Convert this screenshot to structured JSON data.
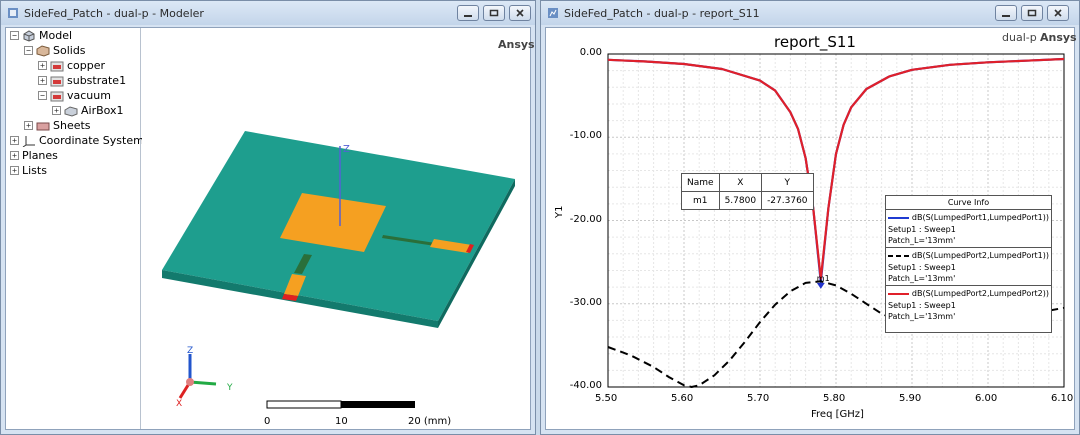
{
  "left_window": {
    "title": "SideFed_Patch - dual-p - Modeler",
    "tree": {
      "items": [
        {
          "label": "Model",
          "level": 0,
          "expander": "−"
        },
        {
          "label": "Solids",
          "level": 1,
          "expander": "−"
        },
        {
          "label": "copper",
          "level": 2,
          "expander": "+"
        },
        {
          "label": "substrate1",
          "level": 2,
          "expander": "+"
        },
        {
          "label": "vacuum",
          "level": 2,
          "expander": "−"
        },
        {
          "label": "AirBox1",
          "level": 3,
          "expander": "+"
        },
        {
          "label": "Sheets",
          "level": 1,
          "expander": "+"
        },
        {
          "label": "Coordinate Systems",
          "level": 0,
          "expander": "+"
        },
        {
          "label": "Planes",
          "level": 0,
          "expander": "+"
        },
        {
          "label": "Lists",
          "level": 0,
          "expander": "+"
        }
      ]
    },
    "view": {
      "brand": "Ansys",
      "axis_z": "Z",
      "triad": {
        "z": "Z",
        "x": "X",
        "y": "Y"
      },
      "scale_ticks": [
        "0",
        "10",
        "20 (mm)"
      ],
      "colors": {
        "substrate": "#1e9e8e",
        "patch": "#f5a021",
        "port": "#e02020"
      }
    }
  },
  "right_window": {
    "title": "SideFed_Patch - dual-p - report_S11",
    "brand": "Ansys",
    "design_label": "dual-p",
    "marker_table": {
      "headers": [
        "Name",
        "X",
        "Y"
      ],
      "rows": [
        [
          "m1",
          "5.7800",
          "-27.3760"
        ]
      ]
    },
    "marker_label": "m1",
    "curve_info": {
      "title": "Curve Info",
      "entries": [
        {
          "name": "dB(S(LumpedPort1,LumpedPort1))",
          "setup": "Setup1 : Sweep1",
          "param": "Patch_L='13mm'",
          "color": "#1f3bd1",
          "style": "solid"
        },
        {
          "name": "dB(S(LumpedPort2,LumpedPort1))",
          "setup": "Setup1 : Sweep1",
          "param": "Patch_L='13mm'",
          "color": "#000000",
          "style": "dashed"
        },
        {
          "name": "dB(S(LumpedPort2,LumpedPort2))",
          "setup": "Setup1 : Sweep1",
          "param": "Patch_L='13mm'",
          "color": "#e0202a",
          "style": "solid"
        }
      ]
    }
  },
  "chart_data": {
    "type": "line",
    "title": "report_S11",
    "xlabel": "Freq [GHz]",
    "ylabel": "Y1",
    "xlim": [
      5.5,
      6.1
    ],
    "ylim": [
      -40,
      0
    ],
    "x_ticks": [
      "5.50",
      "5.60",
      "5.70",
      "5.80",
      "5.90",
      "6.00",
      "6.10"
    ],
    "y_ticks": [
      "0.00",
      "-10.00",
      "-20.00",
      "-30.00",
      "-40.00"
    ],
    "grid": true,
    "legend_position": "right",
    "series": [
      {
        "name": "dB(S(LumpedPort1,LumpedPort1))",
        "color": "#1f3bd1",
        "style": "solid",
        "x": [
          5.5,
          5.55,
          5.6,
          5.65,
          5.7,
          5.72,
          5.74,
          5.75,
          5.76,
          5.77,
          5.78,
          5.79,
          5.8,
          5.81,
          5.82,
          5.84,
          5.87,
          5.9,
          5.95,
          6.0,
          6.05,
          6.1
        ],
        "y": [
          -0.7,
          -0.9,
          -1.2,
          -1.8,
          -3.2,
          -4.4,
          -7.0,
          -9.0,
          -12.5,
          -18.5,
          -27.4,
          -18.5,
          -12.0,
          -8.5,
          -6.4,
          -4.2,
          -2.7,
          -1.9,
          -1.3,
          -1.0,
          -0.8,
          -0.6
        ]
      },
      {
        "name": "dB(S(LumpedPort2,LumpedPort1))",
        "color": "#000000",
        "style": "dashed",
        "x": [
          5.5,
          5.53,
          5.56,
          5.58,
          5.6,
          5.61,
          5.62,
          5.64,
          5.66,
          5.68,
          5.7,
          5.72,
          5.74,
          5.76,
          5.78,
          5.8,
          5.82,
          5.84,
          5.86,
          5.88,
          5.9,
          5.93,
          5.96,
          6.0,
          6.05,
          6.1
        ],
        "y": [
          -35.2,
          -36.2,
          -37.6,
          -38.8,
          -39.8,
          -40.0,
          -39.8,
          -38.6,
          -36.8,
          -34.6,
          -32.2,
          -30.1,
          -28.5,
          -27.5,
          -27.3,
          -27.8,
          -28.8,
          -30.0,
          -31.2,
          -32.0,
          -32.6,
          -32.8,
          -32.6,
          -32.0,
          -31.3,
          -30.5
        ]
      },
      {
        "name": "dB(S(LumpedPort2,LumpedPort2))",
        "color": "#e0202a",
        "style": "solid",
        "x": [
          5.5,
          5.55,
          5.6,
          5.65,
          5.7,
          5.72,
          5.74,
          5.75,
          5.76,
          5.77,
          5.78,
          5.79,
          5.8,
          5.81,
          5.82,
          5.84,
          5.87,
          5.9,
          5.95,
          6.0,
          6.05,
          6.1
        ],
        "y": [
          -0.7,
          -0.9,
          -1.2,
          -1.8,
          -3.2,
          -4.4,
          -7.0,
          -9.0,
          -12.5,
          -18.5,
          -27.0,
          -18.5,
          -12.0,
          -8.5,
          -6.4,
          -4.2,
          -2.7,
          -1.9,
          -1.3,
          -1.0,
          -0.8,
          -0.6
        ]
      }
    ],
    "marker": {
      "name": "m1",
      "x": 5.78,
      "y": -27.376
    }
  }
}
